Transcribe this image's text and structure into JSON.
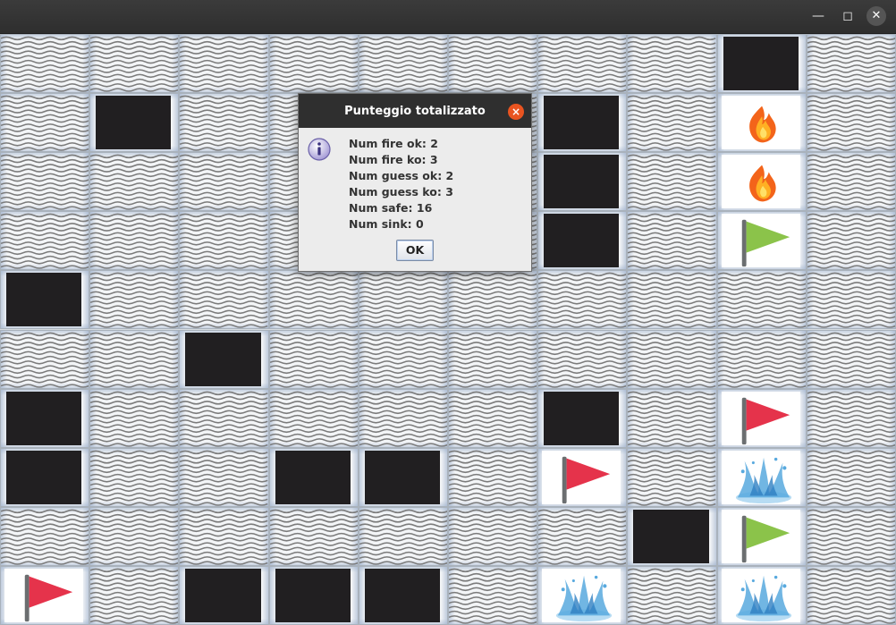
{
  "window": {
    "title": "",
    "minimize_icon": "minimize-icon",
    "maximize_icon": "maximize-icon",
    "close_icon": "close-icon"
  },
  "board": {
    "rows": 10,
    "cols": 10,
    "legend": {
      "W": "water",
      "D": "dark",
      "F": "fire",
      "G": "green-flag",
      "R": "red-flag",
      "S": "splash"
    },
    "cells": [
      "WWWWWWWWDW",
      "WDWWWWDWFW",
      "WWWWWWDWFW",
      "WWWWWWDWGW",
      "DWWWWWWWWW",
      "WWDWWWWWWW",
      "DWWWWWDWRW",
      "DWWDDWRWSW",
      "WWWWWWWDGW",
      "RWDDDWSWSW"
    ]
  },
  "dialog": {
    "title": "Punteggio totalizzato",
    "icon": "info-icon",
    "lines": [
      "Num fire ok: 2",
      "Num fire ko: 3",
      "Num guess ok: 2",
      "Num guess ko: 3",
      "Num safe: 16",
      "Num sink: 0"
    ],
    "ok_label": "OK",
    "close_symbol": "×"
  },
  "colors": {
    "titlebar": "#2f2f2f",
    "dialog_close": "#e95420",
    "dark_cell": "#211f21",
    "flag_red": "#e5334b",
    "flag_green": "#8bc34a"
  }
}
